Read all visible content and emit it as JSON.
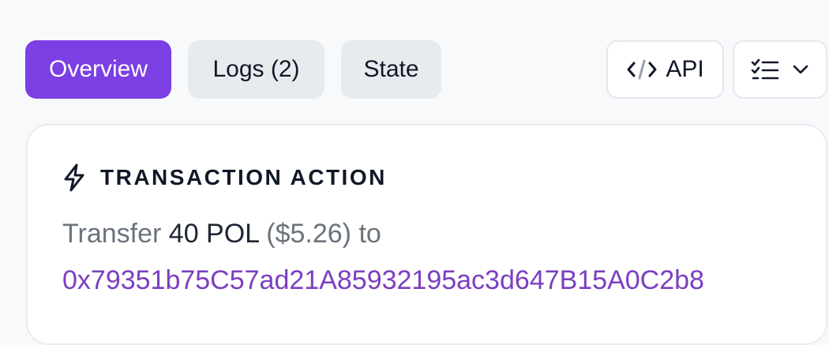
{
  "tabs": {
    "overview": "Overview",
    "logs": "Logs (2)",
    "state": "State"
  },
  "toolbar": {
    "api_label": "API"
  },
  "action": {
    "title": "TRANSACTION ACTION",
    "verb": "Transfer",
    "amount": "40 POL",
    "fiat": "($5.26)",
    "preposition": "to",
    "address": "0x79351b75C57ad21A85932195ac3d647B15A0C2b8"
  },
  "colors": {
    "accent": "#7b3fe4",
    "link": "#7b3fc0"
  },
  "icons": {
    "api": "code-icon",
    "menu": "checklist-icon",
    "dropdown": "chevron-down-icon",
    "action": "lightning-bolt-icon"
  }
}
